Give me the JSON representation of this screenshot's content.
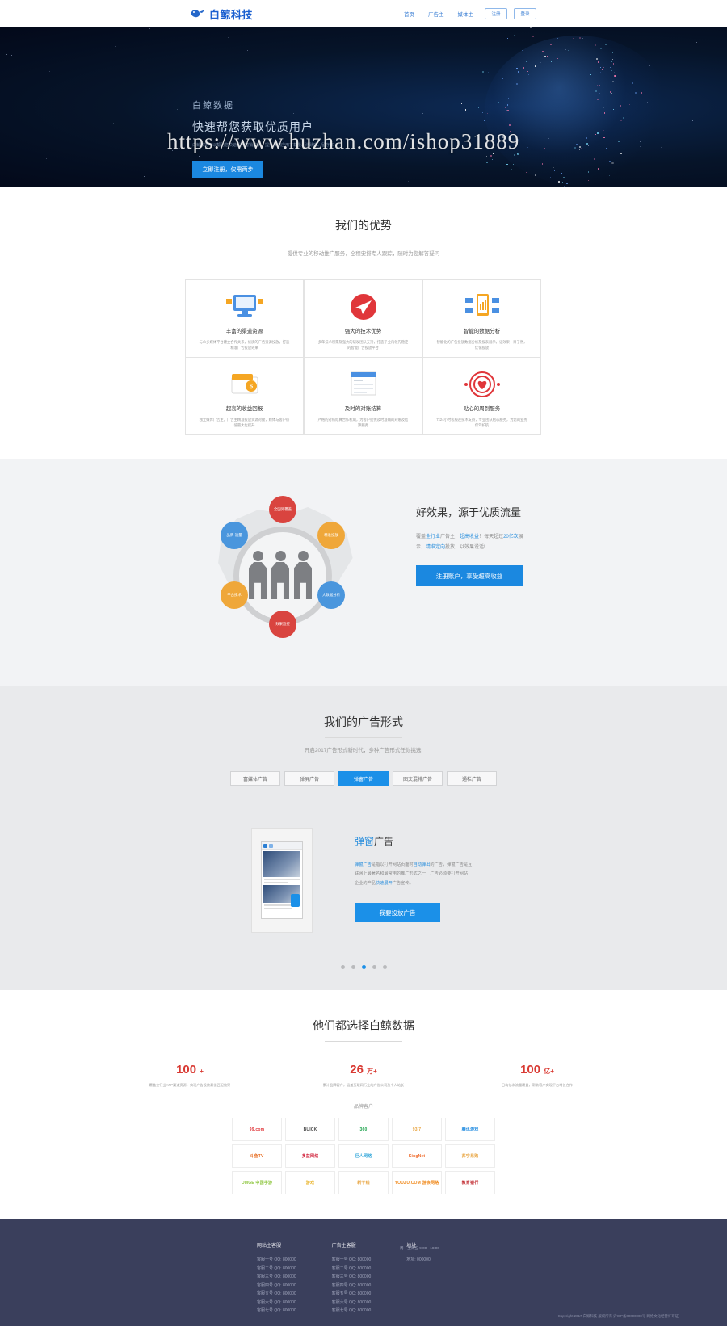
{
  "header": {
    "logo_text": "白鲸科技",
    "logo_icon": "whale-icon",
    "nav": [
      {
        "label": "首页"
      },
      {
        "label": "广告主"
      },
      {
        "label": "媒体主"
      }
    ],
    "register_label": "注册",
    "login_label": "登录"
  },
  "hero": {
    "title": "白鲸数据",
    "subtitle": "快速帮您获取优质用户",
    "desc": "白鲸数据可以帮助您快速提升营销效果，提升移动应用下载量、活跃度、留存率",
    "cta": "立即注册，仅需两步",
    "watermark": "https://www.huzhan.com/ishop31889"
  },
  "advantages": {
    "title": "我们的优势",
    "subtitle": "提供专业的移动推广服务，全程安排专人跟踪，随时为您解答疑问",
    "cards": [
      {
        "icon": "monitor-icon",
        "name": "丰富的渠道资源",
        "desc": "与众多媒体平台建立合作关系，优质的广告资源投放，打造精准广告投放效果"
      },
      {
        "icon": "rocket-icon",
        "name": "强大的技术优势",
        "desc": "多年技术积累及强大的研发团队支持，打造了业内领先稳定的智能广告投放平台"
      },
      {
        "icon": "mobile-chart-icon",
        "name": "智能的数据分析",
        "desc": "智能化的广告投放数据分析及报表展示，让效果一目了然，优化投放"
      },
      {
        "icon": "wallet-icon",
        "name": "超高的收益回报",
        "desc": "独立媒体广告主，广告主精准投放资源对接，媒体与客户价值最大化提升"
      },
      {
        "icon": "document-icon",
        "name": "及时的对账结算",
        "desc": "严格的对账结算合作机制，为客户提供及时准确的对账及结算服务"
      },
      {
        "icon": "heart-icon",
        "name": "贴心的周到服务",
        "desc": "7x24小时客服及技术支持，专业团队贴心服务，为您的业务保驾护航"
      }
    ]
  },
  "traffic": {
    "bubbles": [
      {
        "label": "全国外覆盖",
        "color": "#d9443f"
      },
      {
        "label": "精准投放",
        "color": "#efa73a"
      },
      {
        "label": "大数据分析",
        "color": "#4a96dd"
      },
      {
        "label": "效果监控",
        "color": "#d9443f"
      },
      {
        "label": "平台技术",
        "color": "#efa73a"
      },
      {
        "label": "品牌·流量",
        "color": "#4a96dd"
      }
    ],
    "heading": "好效果，源于优质流量",
    "paragraph_parts": [
      {
        "text": "覆盖",
        "highlight": false
      },
      {
        "text": "全行业",
        "highlight": true
      },
      {
        "text": "广告主，",
        "highlight": false
      },
      {
        "text": "超高收益",
        "highlight": true
      },
      {
        "text": "！每天超过",
        "highlight": false
      },
      {
        "text": "20亿次",
        "highlight": true
      },
      {
        "text": "展示，",
        "highlight": false
      },
      {
        "text": "精准定向",
        "highlight": true
      },
      {
        "text": "投放，以效果说话!",
        "highlight": false
      }
    ],
    "cta": "注册账户，享受超高收益"
  },
  "formats": {
    "title": "我们的广告形式",
    "subtitle": "开启2017广告形式新时代，多种广告形式任你挑选!",
    "tabs": [
      {
        "label": "富媒体广告",
        "active": false
      },
      {
        "label": "弹屏广告",
        "active": false
      },
      {
        "label": "弹窗广告",
        "active": true
      },
      {
        "label": "图文混排广告",
        "active": false
      },
      {
        "label": "通栏广告",
        "active": false
      }
    ],
    "detail_heading_highlight": "弹窗",
    "detail_heading_rest": "广告",
    "detail_paragraph_parts": [
      {
        "text": "弹窗广告",
        "highlight": true
      },
      {
        "text": "是指以打开网站页面时",
        "highlight": false
      },
      {
        "text": "自动弹出",
        "highlight": true
      },
      {
        "text": "的广告，弹窗广告是互联网上最著名和最常用的推广形式之一，广告必须要打开网站，企业的产品",
        "highlight": false
      },
      {
        "text": "快速展开",
        "highlight": true
      },
      {
        "text": "广告宣传。",
        "highlight": false
      }
    ],
    "cta": "我要投放广告",
    "dots": [
      {
        "active": false
      },
      {
        "active": false
      },
      {
        "active": true
      },
      {
        "active": false
      },
      {
        "active": false
      }
    ]
  },
  "clients": {
    "title": "他们都选择白鲸数据",
    "stats": [
      {
        "number": "100",
        "unit": "+",
        "desc": "覆盖全行业APP渠道资源，实现广告投放最佳匹配效果"
      },
      {
        "number": "26",
        "unit": "万+",
        "desc": "累计品牌客户，涵盖互联网行业的广告公司及个人站长"
      },
      {
        "number": "100",
        "unit": "亿+",
        "desc": "日均亿次流量覆盖，帮助客户实现平台增长合作"
      }
    ],
    "label": "品牌客户",
    "logos": [
      {
        "name": "99.com"
      },
      {
        "name": "BUICK"
      },
      {
        "name": "360"
      },
      {
        "name": "93.7"
      },
      {
        "name": "腾讯游戏"
      },
      {
        "name": "斗鱼TV"
      },
      {
        "name": "多益网络"
      },
      {
        "name": "巨人网络"
      },
      {
        "name": "KingNet"
      },
      {
        "name": "苏宁易购"
      },
      {
        "name": "OMGE 中国手游"
      },
      {
        "name": "游戏"
      },
      {
        "name": "新干线"
      },
      {
        "name": "YOUZU.COM 游族网络"
      },
      {
        "name": "教育银行"
      }
    ]
  },
  "footer": {
    "columns": [
      {
        "heading": "网站主客服",
        "items": [
          "客服一号 QQ: 800000",
          "客服二号 QQ: 800000",
          "客服三号 QQ: 800000",
          "客服四号 QQ: 800000",
          "客服五号 QQ: 800000",
          "客服六号 QQ: 800000",
          "客服七号 QQ: 800000"
        ]
      },
      {
        "heading": "广告主客服",
        "items": [
          "客服一号 QQ: 800000",
          "客服二号 QQ: 800000",
          "客服三号 QQ: 800000",
          "客服四号 QQ: 800000",
          "客服五号 QQ: 800000",
          "客服六号 QQ: 800000",
          "客服七号 QQ: 800000"
        ]
      },
      {
        "heading": "地址",
        "items": [
          "地址: 000000"
        ]
      }
    ],
    "hours": "周一至周五 9:00 - 18:00",
    "copyright": "Copyright 2017 白鲸科技 版权所有 沪ICP备00000000号 网络文化经营许可证"
  }
}
